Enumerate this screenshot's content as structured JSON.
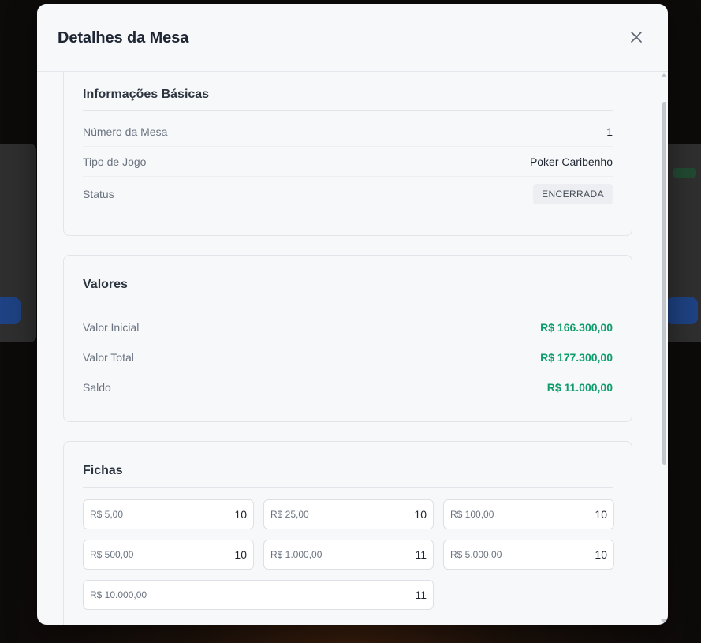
{
  "modal": {
    "title": "Detalhes da Mesa",
    "close_icon": "close-icon"
  },
  "basic_info": {
    "title": "Informações Básicas",
    "table_number_label": "Número da Mesa",
    "table_number_value": "1",
    "game_type_label": "Tipo de Jogo",
    "game_type_value": "Poker Caribenho",
    "status_label": "Status",
    "status_value": "ENCERRADA"
  },
  "values": {
    "title": "Valores",
    "initial_label": "Valor Inicial",
    "initial_value": "R$ 166.300,00",
    "total_label": "Valor Total",
    "total_value": "R$ 177.300,00",
    "balance_label": "Saldo",
    "balance_value": "R$ 11.000,00"
  },
  "chips": {
    "title": "Fichas",
    "items": [
      {
        "label": "R$ 5,00",
        "qty": "10"
      },
      {
        "label": "R$ 25,00",
        "qty": "10"
      },
      {
        "label": "R$ 100,00",
        "qty": "10"
      },
      {
        "label": "R$ 500,00",
        "qty": "10"
      },
      {
        "label": "R$ 1.000,00",
        "qty": "11"
      },
      {
        "label": "R$ 5.000,00",
        "qty": "10"
      },
      {
        "label": "R$ 10.000,00",
        "qty": "11"
      }
    ]
  },
  "colors": {
    "money": "#0f9d6b",
    "badge_bg": "#eceef1",
    "modal_bg": "#f6f8fa"
  }
}
